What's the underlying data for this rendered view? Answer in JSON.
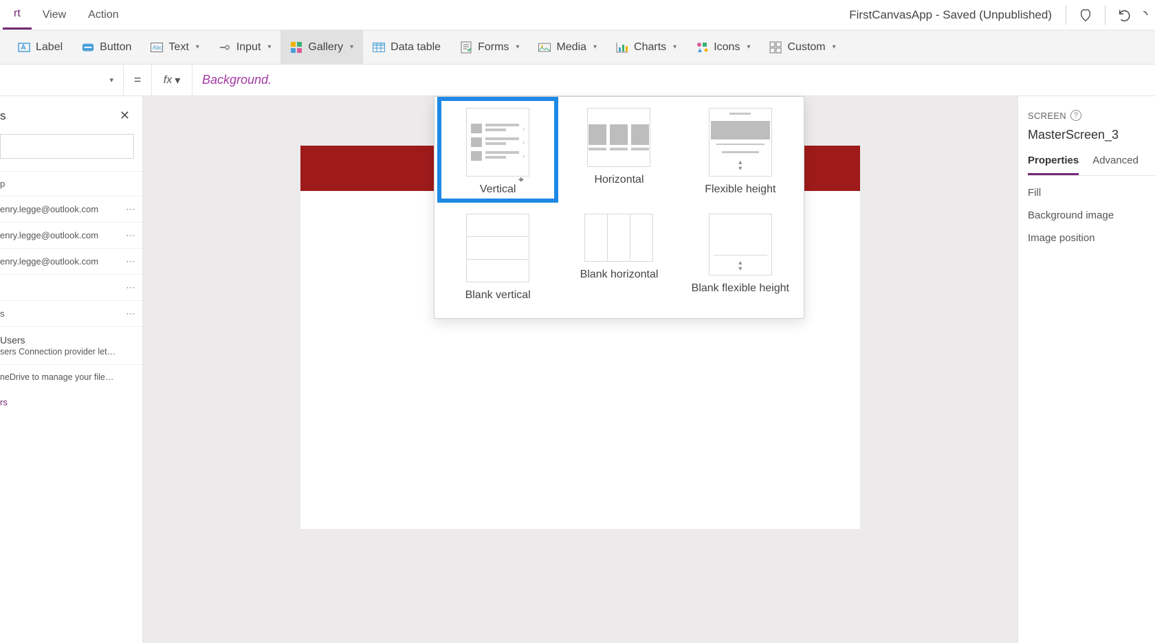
{
  "menubar": {
    "tabs": [
      "rt",
      "View",
      "Action"
    ],
    "active_index": 0,
    "app_title": "FirstCanvasApp - Saved (Unpublished)"
  },
  "ribbon": {
    "items": [
      {
        "label": "Label",
        "icon": "label-icon",
        "dropdown": false
      },
      {
        "label": "Button",
        "icon": "button-icon",
        "dropdown": false
      },
      {
        "label": "Text",
        "icon": "text-icon",
        "dropdown": true
      },
      {
        "label": "Input",
        "icon": "input-icon",
        "dropdown": true
      },
      {
        "label": "Gallery",
        "icon": "gallery-icon",
        "dropdown": true,
        "active": true
      },
      {
        "label": "Data table",
        "icon": "datatable-icon",
        "dropdown": false
      },
      {
        "label": "Forms",
        "icon": "forms-icon",
        "dropdown": true
      },
      {
        "label": "Media",
        "icon": "media-icon",
        "dropdown": true
      },
      {
        "label": "Charts",
        "icon": "charts-icon",
        "dropdown": true
      },
      {
        "label": "Icons",
        "icon": "icons-icon",
        "dropdown": true
      },
      {
        "label": "Custom",
        "icon": "custom-icon",
        "dropdown": true
      }
    ]
  },
  "formulabar": {
    "equals": "=",
    "fx": "fx",
    "formula": "Background."
  },
  "leftpane": {
    "title": "s",
    "items": [
      {
        "text": "p"
      },
      {
        "text": "enry.legge@outlook.com",
        "more": true
      },
      {
        "text": "enry.legge@outlook.com",
        "more": true
      },
      {
        "text": "enry.legge@outlook.com",
        "more": true
      },
      {
        "text": "",
        "more": true
      },
      {
        "text": "s",
        "more": true
      },
      {
        "title": "Users",
        "desc": "sers Connection provider lets you ..."
      },
      {
        "desc": "neDrive to manage your files. Yo..."
      }
    ],
    "link": "rs"
  },
  "gallery_dropdown": {
    "options": [
      {
        "label": "Vertical",
        "selected": true,
        "kind": "vertical"
      },
      {
        "label": "Horizontal",
        "kind": "horizontal"
      },
      {
        "label": "Flexible height",
        "kind": "flex"
      },
      {
        "label": "Blank vertical",
        "kind": "bvert"
      },
      {
        "label": "Blank horizontal",
        "kind": "bhoriz"
      },
      {
        "label": "Blank flexible height",
        "kind": "bflex"
      }
    ]
  },
  "rightpane": {
    "section": "SCREEN",
    "screen_name": "MasterScreen_3",
    "tabs": [
      "Properties",
      "Advanced"
    ],
    "active_tab": 0,
    "props": [
      "Fill",
      "Background image",
      "Image position"
    ]
  }
}
